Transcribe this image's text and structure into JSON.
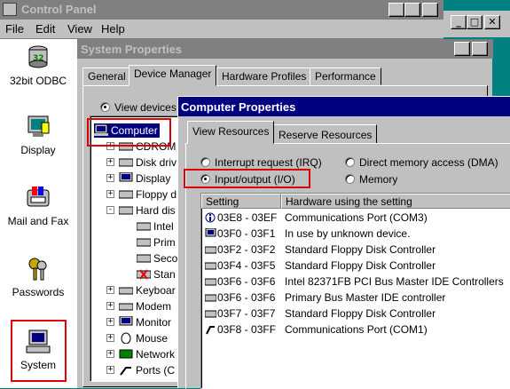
{
  "control_panel": {
    "title": "Control Panel",
    "menu": [
      "File",
      "Edit",
      "View",
      "Help"
    ],
    "icons": [
      {
        "label": "32bit ODBC",
        "icon": "odbc-icon"
      },
      {
        "label": "Display",
        "icon": "display-icon"
      },
      {
        "label": "Mail and Fax",
        "icon": "mail-fax-icon"
      },
      {
        "label": "Passwords",
        "icon": "keys-icon"
      },
      {
        "label": "System",
        "icon": "computer-icon"
      }
    ]
  },
  "system_properties": {
    "title": "System Properties",
    "tabs": [
      "General",
      "Device Manager",
      "Hardware Profiles",
      "Performance"
    ],
    "view_option": "View devices",
    "tree": [
      {
        "label": "Computer",
        "selected": true
      },
      {
        "label": "CDROM"
      },
      {
        "label": "Disk driv"
      },
      {
        "label": "Display"
      },
      {
        "label": "Floppy d"
      },
      {
        "label": "Hard dis"
      },
      {
        "label": "Intel"
      },
      {
        "label": "Prim"
      },
      {
        "label": "Seco"
      },
      {
        "label": "Stan"
      },
      {
        "label": "Keyboar"
      },
      {
        "label": "Modem"
      },
      {
        "label": "Monitor"
      },
      {
        "label": "Mouse"
      },
      {
        "label": "Network"
      },
      {
        "label": "Ports (C"
      }
    ]
  },
  "computer_properties": {
    "title": "Computer Properties",
    "tabs": [
      "View Resources",
      "Reserve Resources"
    ],
    "options": [
      {
        "label": "Interrupt request (IRQ)",
        "selected": false
      },
      {
        "label": "Direct memory access (DMA)",
        "selected": false
      },
      {
        "label": "Input/output (I/O)",
        "selected": true
      },
      {
        "label": "Memory",
        "selected": false
      }
    ],
    "columns": [
      "Setting",
      "Hardware using the setting"
    ],
    "rows": [
      {
        "setting": "03E8 - 03EF",
        "hardware": "Communications Port (COM3)",
        "icon": "info-icon"
      },
      {
        "setting": "03F0 - 03F1",
        "hardware": "In use by unknown device.",
        "icon": "monitor-icon"
      },
      {
        "setting": "03F2 - 03F2",
        "hardware": "Standard Floppy Disk Controller",
        "icon": "drive-icon"
      },
      {
        "setting": "03F4 - 03F5",
        "hardware": "Standard Floppy Disk Controller",
        "icon": "drive-icon"
      },
      {
        "setting": "03F6 - 03F6",
        "hardware": "Intel 82371FB PCI Bus Master IDE Controllers",
        "icon": "drive-icon"
      },
      {
        "setting": "03F6 - 03F6",
        "hardware": "Primary Bus Master IDE controller",
        "icon": "drive-icon"
      },
      {
        "setting": "03F7 - 03F7",
        "hardware": "Standard Floppy Disk Controller",
        "icon": "drive-icon"
      },
      {
        "setting": "03F8 - 03FF",
        "hardware": "Communications Port (COM1)",
        "icon": "port-icon"
      }
    ]
  }
}
